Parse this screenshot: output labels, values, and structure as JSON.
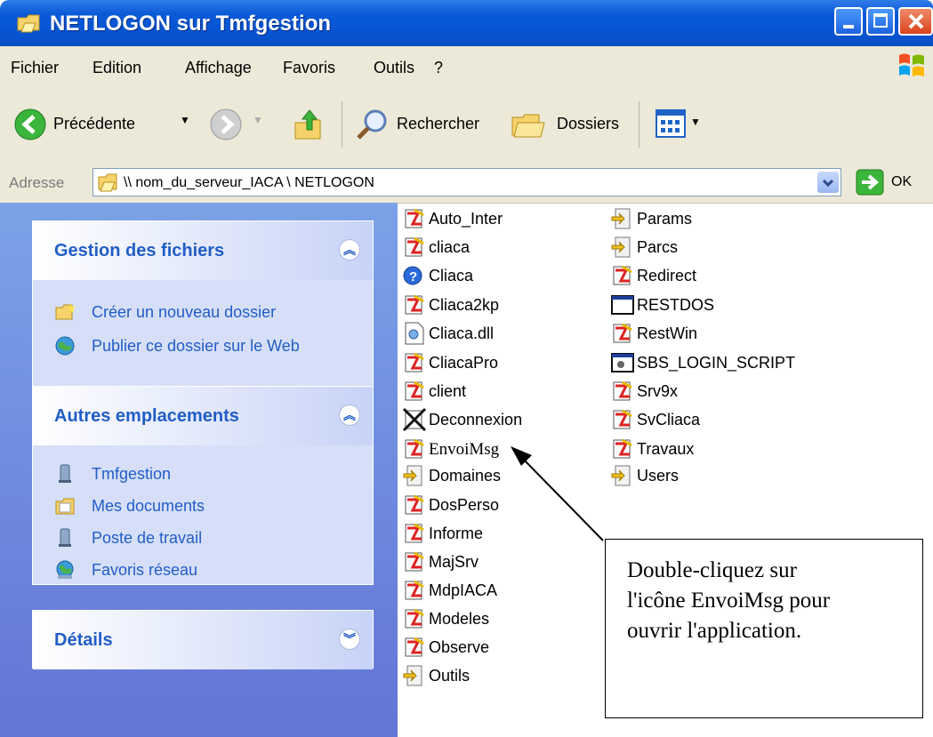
{
  "window": {
    "title": "NETLOGON sur Tmfgestion"
  },
  "menu": [
    "Fichier",
    "Edition",
    "Affichage",
    "Favoris",
    "Outils",
    "?"
  ],
  "toolbar": {
    "back_label": "Précédente",
    "search_label": "Rechercher",
    "folders_label": "Dossiers"
  },
  "address": {
    "label": "Adresse",
    "value": "\\\\ nom_du_serveur_IACA \\ NETLOGON",
    "go_label": "OK"
  },
  "panels": {
    "file_tasks": {
      "title": "Gestion des fichiers",
      "items": [
        "Créer un nouveau dossier",
        "Publier ce dossier sur le Web"
      ]
    },
    "other_places": {
      "title": "Autres emplacements",
      "items": [
        "Tmfgestion",
        "Mes documents",
        "Poste de travail",
        "Favoris réseau"
      ]
    },
    "details": {
      "title": "Détails"
    }
  },
  "files": {
    "col1": [
      "Auto_Inter",
      "cliaca",
      "Cliaca",
      "Cliaca2kp",
      "Cliaca.dll",
      "CliacaPro",
      "client",
      "Deconnexion",
      "EnvoiMsg",
      "Domaines",
      "DosPerso",
      "Informe",
      "MajSrv",
      "MdpIACA",
      "Modeles",
      "Observe",
      "Outils"
    ],
    "col2": [
      "Params",
      "Parcs",
      "Redirect",
      "RESTDOS",
      "RestWin",
      "SBS_LOGIN_SCRIPT",
      "Srv9x",
      "SvCliaca",
      "Travaux",
      "Users"
    ]
  },
  "callout": {
    "text": "Double-cliquez sur\nl'icône EnvoiMsg pour\nouvrir l'application."
  }
}
